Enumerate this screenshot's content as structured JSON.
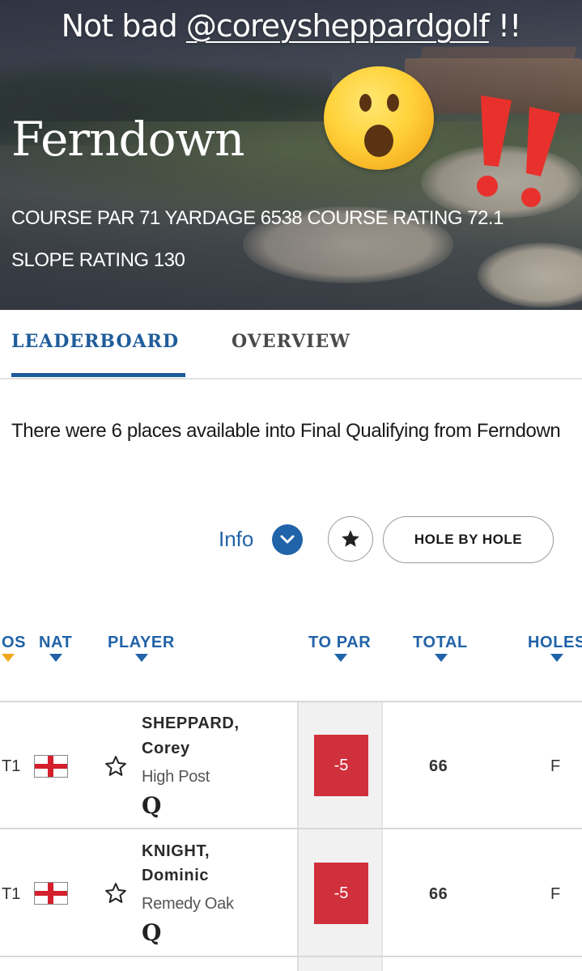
{
  "story": {
    "caption_prefix": "Not bad ",
    "mention": "@coreysheppardgolf",
    "caption_suffix": " !!"
  },
  "course": {
    "name": "Ferndown",
    "stats_line": "COURSE PAR 71 YARDAGE 6538 COURSE RATING 72.1 SLOPE RATING 130"
  },
  "tabs": [
    {
      "label": "LEADERBOARD",
      "active": true
    },
    {
      "label": "OVERVIEW",
      "active": false
    }
  ],
  "intro_text": "There were 6 places available into Final Qualifying from Ferndown",
  "controls": {
    "info_label": "Info",
    "hole_by_hole_label": "HOLE BY HOLE",
    "favorites_icon": "star-filled-icon",
    "info_icon": "chevron-down-icon"
  },
  "table": {
    "columns": [
      "OS",
      "NAT",
      "PLAYER",
      "TO PAR",
      "TOTAL",
      "HOLES"
    ],
    "rows": [
      {
        "pos": "T1",
        "nat": "England",
        "surname": "SHEPPARD,",
        "firstname": "Corey",
        "club": "High Post",
        "qualified": "Q",
        "to_par": "-5",
        "total": "66",
        "holes": "F"
      },
      {
        "pos": "T1",
        "nat": "England",
        "surname": "KNIGHT,",
        "firstname": "Dominic",
        "club": "Remedy Oak",
        "qualified": "Q",
        "to_par": "-5",
        "total": "66",
        "holes": "F"
      }
    ]
  },
  "colors": {
    "accent": "#2163a8",
    "sort_active": "#f0a71c",
    "score_under_par": "#d0303b"
  }
}
